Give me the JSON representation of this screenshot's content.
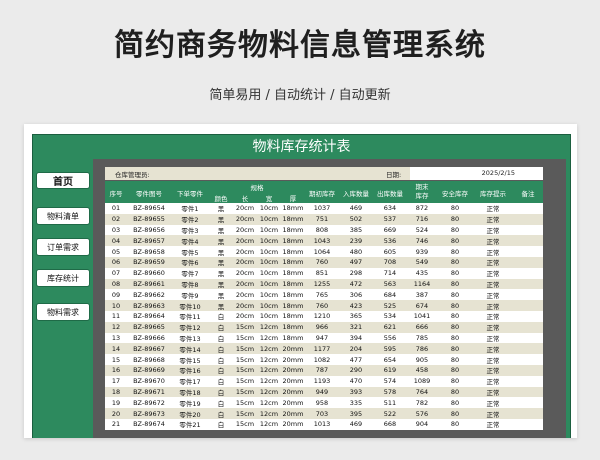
{
  "page": {
    "title": "简约商务物料信息管理系统",
    "subtitle": "简单易用 / 自动统计 / 自动更新"
  },
  "sheet": {
    "title": "物料库存统计表",
    "nav": [
      "首页",
      "物料清单",
      "订单需求",
      "库存统计",
      "物料需求"
    ],
    "manager_label": "仓库管理员:",
    "date_label": "日期:",
    "date_value": "2025/2/15",
    "headers": {
      "seq": "序号",
      "code": "零件图号",
      "name": "下单零件",
      "spec": "规格",
      "color": "颜色",
      "length": "长",
      "width": "宽",
      "thick": "厚",
      "opening": "期初库存",
      "inbound": "入库数量",
      "outbound": "出库数量",
      "closing": "期末库存",
      "safety": "安全库存",
      "alert": "库存提示",
      "remark": "备注"
    },
    "rows": [
      [
        "01",
        "BZ-89654",
        "零件1",
        "黑",
        "20cm",
        "10cm",
        "18mm",
        "1037",
        "469",
        "634",
        "872",
        "80",
        "正常",
        ""
      ],
      [
        "02",
        "BZ-89655",
        "零件2",
        "黑",
        "20cm",
        "10cm",
        "18mm",
        "751",
        "502",
        "537",
        "716",
        "80",
        "正常",
        ""
      ],
      [
        "03",
        "BZ-89656",
        "零件3",
        "黑",
        "20cm",
        "10cm",
        "18mm",
        "808",
        "385",
        "669",
        "524",
        "80",
        "正常",
        ""
      ],
      [
        "04",
        "BZ-89657",
        "零件4",
        "黑",
        "20cm",
        "10cm",
        "18mm",
        "1043",
        "239",
        "536",
        "746",
        "80",
        "正常",
        ""
      ],
      [
        "05",
        "BZ-89658",
        "零件5",
        "黑",
        "20cm",
        "10cm",
        "18mm",
        "1064",
        "480",
        "605",
        "939",
        "80",
        "正常",
        ""
      ],
      [
        "06",
        "BZ-89659",
        "零件6",
        "黑",
        "20cm",
        "10cm",
        "18mm",
        "760",
        "497",
        "708",
        "549",
        "80",
        "正常",
        ""
      ],
      [
        "07",
        "BZ-89660",
        "零件7",
        "黑",
        "20cm",
        "10cm",
        "18mm",
        "851",
        "298",
        "714",
        "435",
        "80",
        "正常",
        ""
      ],
      [
        "08",
        "BZ-89661",
        "零件8",
        "黑",
        "20cm",
        "10cm",
        "18mm",
        "1255",
        "472",
        "563",
        "1164",
        "80",
        "正常",
        ""
      ],
      [
        "09",
        "BZ-89662",
        "零件9",
        "黑",
        "20cm",
        "10cm",
        "18mm",
        "765",
        "306",
        "684",
        "387",
        "80",
        "正常",
        ""
      ],
      [
        "10",
        "BZ-89663",
        "零件10",
        "黑",
        "20cm",
        "10cm",
        "18mm",
        "760",
        "423",
        "525",
        "674",
        "80",
        "正常",
        ""
      ],
      [
        "11",
        "BZ-89664",
        "零件11",
        "白",
        "20cm",
        "10cm",
        "18mm",
        "1210",
        "365",
        "534",
        "1041",
        "80",
        "正常",
        ""
      ],
      [
        "12",
        "BZ-89665",
        "零件12",
        "白",
        "15cm",
        "12cm",
        "18mm",
        "966",
        "321",
        "621",
        "666",
        "80",
        "正常",
        ""
      ],
      [
        "13",
        "BZ-89666",
        "零件13",
        "白",
        "15cm",
        "12cm",
        "18mm",
        "947",
        "394",
        "556",
        "785",
        "80",
        "正常",
        ""
      ],
      [
        "14",
        "BZ-89667",
        "零件14",
        "白",
        "15cm",
        "12cm",
        "20mm",
        "1177",
        "204",
        "595",
        "786",
        "80",
        "正常",
        ""
      ],
      [
        "15",
        "BZ-89668",
        "零件15",
        "白",
        "15cm",
        "12cm",
        "20mm",
        "1082",
        "477",
        "654",
        "905",
        "80",
        "正常",
        ""
      ],
      [
        "16",
        "BZ-89669",
        "零件16",
        "白",
        "15cm",
        "12cm",
        "20mm",
        "787",
        "290",
        "619",
        "458",
        "80",
        "正常",
        ""
      ],
      [
        "17",
        "BZ-89670",
        "零件17",
        "白",
        "15cm",
        "12cm",
        "20mm",
        "1193",
        "470",
        "574",
        "1089",
        "80",
        "正常",
        ""
      ],
      [
        "18",
        "BZ-89671",
        "零件18",
        "白",
        "15cm",
        "12cm",
        "20mm",
        "949",
        "393",
        "578",
        "764",
        "80",
        "正常",
        ""
      ],
      [
        "19",
        "BZ-89672",
        "零件19",
        "白",
        "15cm",
        "12cm",
        "20mm",
        "958",
        "335",
        "511",
        "782",
        "80",
        "正常",
        ""
      ],
      [
        "20",
        "BZ-89673",
        "零件20",
        "白",
        "15cm",
        "12cm",
        "20mm",
        "703",
        "395",
        "522",
        "576",
        "80",
        "正常",
        ""
      ],
      [
        "21",
        "BZ-89674",
        "零件21",
        "白",
        "15cm",
        "12cm",
        "20mm",
        "1013",
        "469",
        "668",
        "904",
        "80",
        "正常",
        ""
      ]
    ]
  }
}
